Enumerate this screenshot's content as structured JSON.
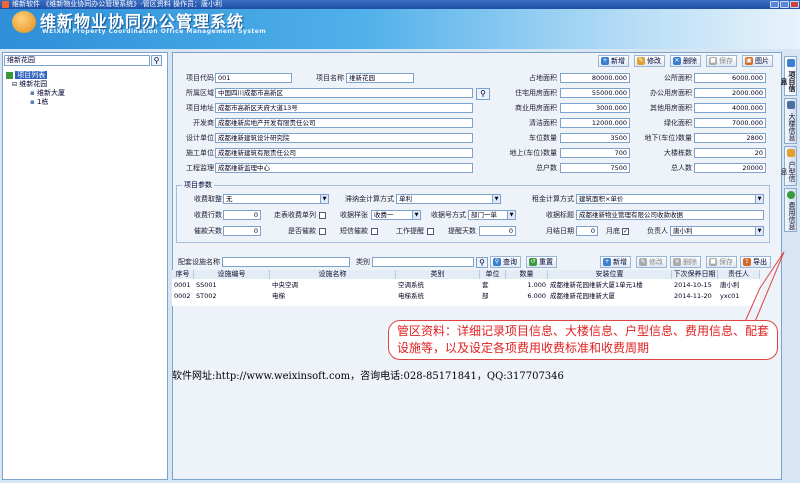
{
  "window": {
    "title": "维新软件 《维新物业协同办公管理系统》-管区资料   操作员：唐小利"
  },
  "banner": {
    "title": "维新物业协同办公管理系统",
    "subtitle": "WEIXIN Property Coordination Office Management System"
  },
  "sidebar": {
    "search_value": "维新花园",
    "tree": {
      "root": "项目列表",
      "project": "维新花园",
      "buildings": [
        "维新大厦",
        "1栋"
      ]
    }
  },
  "toolbar_top": {
    "new": "新增",
    "edit": "修改",
    "delete": "删除",
    "save": "保存",
    "image": "图片"
  },
  "project": {
    "code_label": "项目代码",
    "code_value": "001",
    "name_label": "项目名称",
    "name_value": "维新花园",
    "region_label": "所属区域",
    "region_value": "中国四川成都市高新区",
    "address_label": "项目地址",
    "address_value": "成都市高新区天府大道13号",
    "developer_label": "开发商",
    "developer_value": "成都维新房地产开发有限责任公司",
    "design_label": "设计单位",
    "design_value": "成都维新建筑设计研究院",
    "construction_label": "施工单位",
    "construction_value": "成都维新建筑有限责任公司",
    "supervision_label": "工程监理",
    "supervision_value": "成都维新监理中心",
    "land_area_label": "占地面积",
    "land_area_value": "80000.000",
    "public_area_label": "公所面积",
    "public_area_value": "6000.000",
    "residential_area_label": "住宅用房面积",
    "residential_area_value": "55000.000",
    "office_area_label": "办公用房面积",
    "office_area_value": "2000.000",
    "commercial_area_label": "商业用房面积",
    "commercial_area_value": "3000.000",
    "other_area_label": "其他用房面积",
    "other_area_value": "4000.000",
    "cleaning_area_label": "清洁面积",
    "cleaning_area_value": "12000.000",
    "green_area_label": "绿化面积",
    "green_area_value": "7000.000",
    "parking_label": "车位数量",
    "parking_value": "3500",
    "underground_parking_label": "地下(车位)数量",
    "underground_parking_value": "2800",
    "ground_parking_label": "地上(车位)数量",
    "ground_parking_value": "700",
    "buildings_label": "大楼栋数",
    "buildings_value": "20",
    "households_label": "总户数",
    "households_value": "7500",
    "population_label": "总人数",
    "population_value": "20000"
  },
  "params": {
    "legend": "项目参数",
    "charge_type_label": "收费取整",
    "charge_type_value": "无",
    "late_fee_label": "滞纳金计算方式",
    "late_fee_value": "单利",
    "rent_label": "租金计算方式",
    "rent_value": "建筑面积×单价",
    "rows_label": "收费行数",
    "rows_value": "0",
    "usage_label": "走表收费单列",
    "order_label": "收据样张",
    "order_value": "收费一",
    "receipt_mode_label": "收据号方式",
    "receipt_mode_value": "部门一单",
    "receipt_title_label": "收据标题",
    "receipt_title_value": "成都维新物业管理有限公司收款收据",
    "overdue_days_label": "催款天数",
    "overdue_days_value": "0",
    "urge_label": "是否催款",
    "sms_label": "短信催款",
    "workorder_label": "工作提醒",
    "remind_days_label": "提醒天数",
    "remind_days_value": "0",
    "month_end_label": "月结日期",
    "month_end_value": "0",
    "month_end_suffix": "月底",
    "manager_label": "负责人",
    "manager_value": "唐小利"
  },
  "facilities": {
    "name_label": "配套设施名称",
    "type_label": "类别",
    "search": "查询",
    "reset": "重置",
    "new": "新增",
    "edit": "修改",
    "delete": "删除",
    "save": "保存",
    "export": "导出",
    "columns": [
      "序号",
      "设施编号",
      "设施名称",
      "类别",
      "单位",
      "数量",
      "安装位置",
      "下次保养日期",
      "责任人"
    ],
    "rows": [
      [
        "0001",
        "SS001",
        "中央空调",
        "空调系统",
        "套",
        "1.000",
        "成都维新花园维新大厦1单元1楼",
        "2014-10-15",
        "唐小利"
      ],
      [
        "0002",
        "ST002",
        "电梯",
        "电梯系统",
        "部",
        "6.000",
        "成都维新花园维新大厦",
        "2014-11-20",
        "yxc01"
      ]
    ]
  },
  "vtabs": [
    "项目信息",
    "大楼信息",
    "户型信息",
    "费用信息"
  ],
  "callout": "管区资料：详细记录项目信息、大楼信息、户型信息、费用信息、配套设施等，以及设定各项费用收费标准和收费周期",
  "website": "软件网址:http://www.weixinsoft.com，咨询电话:028-85171841，QQ:317707346"
}
